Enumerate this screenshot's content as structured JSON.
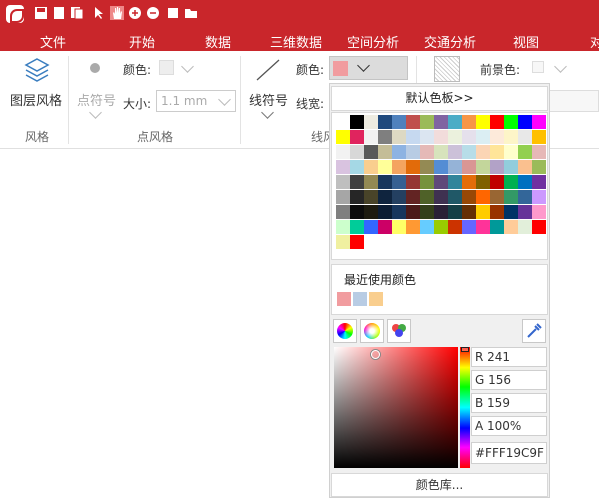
{
  "ribbon": {
    "tabs": [
      "文件",
      "开始",
      "数据",
      "三维数据",
      "空间分析",
      "交通分析",
      "视图",
      "对"
    ]
  },
  "layer_style_group": {
    "button_label": "图层风格",
    "group_label": "风格"
  },
  "point_style_group": {
    "symbol_label": "点符号",
    "color_label": "颜色:",
    "size_label": "大小:",
    "size_value": "1.1 mm",
    "group_label": "点风格"
  },
  "line_style_group": {
    "symbol_label": "线符号",
    "color_label": "颜色:",
    "color_value": "#F19C9F",
    "width_label": "线宽:",
    "group_label": "线风"
  },
  "fill_style_group": {
    "fg_label": "前景色:"
  },
  "color_popup": {
    "default_palette_label": "默认色板>>",
    "recent_label": "最近使用颜色",
    "recent_colors": [
      "#F19C9F",
      "#B8CCE4",
      "#F9CE8E"
    ],
    "r": "R 241",
    "g": "G 156",
    "b": "B 159",
    "a": "A 100%",
    "hex": "#FFF19C9F",
    "library_label": "颜色库...",
    "palette": [
      "#FFFFFF",
      "#000000",
      "#EEECE1",
      "#1F497D",
      "#4F81BD",
      "#C0504D",
      "#9BBB59",
      "#8064A2",
      "#4BACC6",
      "#F79646",
      "#FFFF00",
      "#FF0000",
      "#00FF00",
      "#0000FF",
      "#FF00FF",
      "#FFFF00",
      "#E0245E",
      "#F2F2F2",
      "#7F7F7F",
      "#DDD9C3",
      "#C6D9F0",
      "#DBE5F1",
      "#F2DCDB",
      "#EBF1DD",
      "#E5E0EC",
      "#DBEEF3",
      "#FDEADA",
      "#FDF5C8",
      "#E8E8E8",
      "#FFC000",
      "#F2F2F2",
      "#D8D8D8",
      "#595959",
      "#C4BD97",
      "#8DB3E2",
      "#B8CCE4",
      "#E5B9B7",
      "#D7E3BC",
      "#CCC1D9",
      "#B7DDE8",
      "#FBD5B5",
      "#FFE599",
      "#FFFFCC",
      "#92D050",
      "#E6B8B7",
      "#D9C3E0",
      "#A5D8E5",
      "#F9CE8E",
      "#FFFF99",
      "#F4A460",
      "#E26B0A",
      "#948A54",
      "#548DD4",
      "#95B3D7",
      "#D99694",
      "#C3D69B",
      "#B2A2C7",
      "#92CDDC",
      "#FAC08F",
      "#9BBB59",
      "#BFBFBF",
      "#404040",
      "#938953",
      "#17365D",
      "#366092",
      "#953734",
      "#76923C",
      "#5F497A",
      "#31859B",
      "#E36C09",
      "#7F6000",
      "#C00000",
      "#00B050",
      "#0070C0",
      "#7030A0",
      "#A6A6A6",
      "#262626",
      "#494429",
      "#0F243E",
      "#244061",
      "#632423",
      "#4F6128",
      "#3F3151",
      "#205867",
      "#974806",
      "#FF6600",
      "#996633",
      "#339966",
      "#336699",
      "#CC99FF",
      "#7F7F7F",
      "#0C0C0C",
      "#1D1B10",
      "#0B1C33",
      "#17365D",
      "#4B1A19",
      "#343F1A",
      "#2A2036",
      "#153F46",
      "#652F04",
      "#FFCC00",
      "#993300",
      "#003366",
      "#663399",
      "#FF99CC",
      "#CCFFCC",
      "#00CC99",
      "#3366FF",
      "#CC0066",
      "#FFFF66",
      "#FF9933",
      "#66CCFF",
      "#99CC00",
      "#CC3300",
      "#6666FF",
      "#FF3399",
      "#009999",
      "#FFCC99",
      "#E2EFDA",
      "#FF0000"
    ]
  }
}
